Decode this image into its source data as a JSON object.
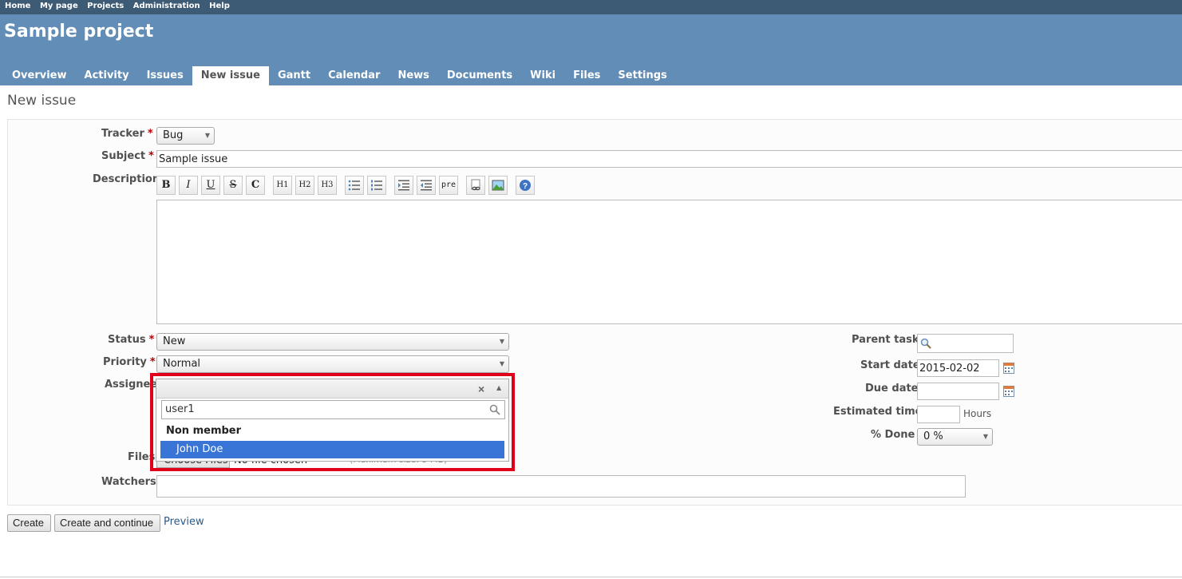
{
  "top_menu": [
    "Home",
    "My page",
    "Projects",
    "Administration",
    "Help"
  ],
  "project_title": "Sample project",
  "tabs": [
    "Overview",
    "Activity",
    "Issues",
    "New issue",
    "Gantt",
    "Calendar",
    "News",
    "Documents",
    "Wiki",
    "Files",
    "Settings"
  ],
  "selected_tab": "New issue",
  "page_title": "New issue",
  "form": {
    "tracker_label": "Tracker",
    "tracker_value": "Bug",
    "subject_label": "Subject",
    "subject_value": "Sample issue",
    "description_label": "Description",
    "toolbar": [
      "B",
      "I",
      "U",
      "S",
      "C",
      "H1",
      "H2",
      "H3",
      "ul",
      "ol",
      "indent",
      "outdent",
      "pre",
      "link",
      "image",
      "help"
    ],
    "status_label": "Status",
    "status_value": "New",
    "priority_label": "Priority",
    "priority_value": "Normal",
    "assignee_label": "Assignee",
    "files_label": "Files",
    "files_button": "Choose Files",
    "files_status": "No file chosen",
    "files_hint": "(Maximum size: 5 MB)",
    "watchers_label": "Watchers",
    "parent_task_label": "Parent task",
    "start_date_label": "Start date",
    "start_date_value": "2015-02-02",
    "due_date_label": "Due date",
    "due_date_value": "",
    "estimated_time_label": "Estimated time",
    "estimated_time_unit": "Hours",
    "done_label": "% Done",
    "done_value": "0 %",
    "required_mark": "*"
  },
  "assignee_dropdown": {
    "search_value": "user1",
    "group_label": "Non member",
    "option": "John Doe",
    "clear_glyph": "×"
  },
  "buttons": {
    "create": "Create",
    "create_continue": "Create and continue",
    "preview": "Preview"
  },
  "colors": {
    "header": "#628db6",
    "top_menu": "#3e5b76",
    "highlight": "#e0001a",
    "selected_option": "#3875d7"
  }
}
